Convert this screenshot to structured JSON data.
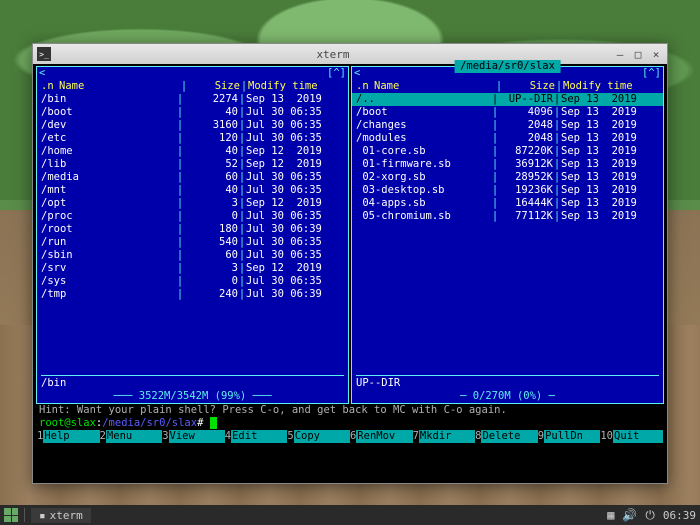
{
  "window": {
    "title": "xterm",
    "minimize": "–",
    "maximize": "□",
    "close": "×"
  },
  "left_panel": {
    "path": "~",
    "headers": {
      "dot": ".n",
      "name": "Name",
      "size": "Size",
      "modify": "Modify time"
    },
    "rows": [
      {
        "name": "/bin",
        "size": "2274",
        "mod": "Sep 13  2019"
      },
      {
        "name": "/boot",
        "size": "40",
        "mod": "Jul 30 06:35"
      },
      {
        "name": "/dev",
        "size": "3160",
        "mod": "Jul 30 06:35"
      },
      {
        "name": "/etc",
        "size": "120",
        "mod": "Jul 30 06:35"
      },
      {
        "name": "/home",
        "size": "40",
        "mod": "Sep 12  2019"
      },
      {
        "name": "/lib",
        "size": "52",
        "mod": "Sep 12  2019"
      },
      {
        "name": "/media",
        "size": "60",
        "mod": "Jul 30 06:35"
      },
      {
        "name": "/mnt",
        "size": "40",
        "mod": "Jul 30 06:35"
      },
      {
        "name": "/opt",
        "size": "3",
        "mod": "Sep 12  2019"
      },
      {
        "name": "/proc",
        "size": "0",
        "mod": "Jul 30 06:35"
      },
      {
        "name": "/root",
        "size": "180",
        "mod": "Jul 30 06:39"
      },
      {
        "name": "/run",
        "size": "540",
        "mod": "Jul 30 06:35"
      },
      {
        "name": "/sbin",
        "size": "60",
        "mod": "Jul 30 06:35"
      },
      {
        "name": "/srv",
        "size": "3",
        "mod": "Sep 12  2019"
      },
      {
        "name": "/sys",
        "size": "0",
        "mod": "Jul 30 06:35"
      },
      {
        "name": "/tmp",
        "size": "240",
        "mod": "Jul 30 06:39"
      }
    ],
    "info": "/bin",
    "disk": "3522M/3542M (99%)"
  },
  "right_panel": {
    "path": "/media/sr0/slax",
    "headers": {
      "dot": ".n",
      "name": "Name",
      "size": "Size",
      "modify": "Modify time"
    },
    "rows": [
      {
        "name": "/..",
        "size": "UP--DIR",
        "mod": "Sep 13  2019",
        "sel": true
      },
      {
        "name": "/boot",
        "size": "4096",
        "mod": "Sep 13  2019"
      },
      {
        "name": "/changes",
        "size": "2048",
        "mod": "Sep 13  2019"
      },
      {
        "name": "/modules",
        "size": "2048",
        "mod": "Sep 13  2019"
      },
      {
        "name": " 01-core.sb",
        "size": "87220K",
        "mod": "Sep 13  2019"
      },
      {
        "name": " 01-firmware.sb",
        "size": "36912K",
        "mod": "Sep 13  2019"
      },
      {
        "name": " 02-xorg.sb",
        "size": "28952K",
        "mod": "Sep 13  2019"
      },
      {
        "name": " 03-desktop.sb",
        "size": "19236K",
        "mod": "Sep 13  2019"
      },
      {
        "name": " 04-apps.sb",
        "size": "16444K",
        "mod": "Sep 13  2019"
      },
      {
        "name": " 05-chromium.sb",
        "size": "77112K",
        "mod": "Sep 13  2019"
      }
    ],
    "info": "UP--DIR",
    "disk": "0/270M (0%)"
  },
  "hint": "Hint: Want your plain shell? Press C-o, and get back to MC with C-o again.",
  "prompt": {
    "user": "root@slax",
    "sep": ":",
    "path": "/media/sr0/slax",
    "end": "#"
  },
  "fkeys": [
    {
      "n": "1",
      "l": "Help"
    },
    {
      "n": "2",
      "l": "Menu"
    },
    {
      "n": "3",
      "l": "View"
    },
    {
      "n": "4",
      "l": "Edit"
    },
    {
      "n": "5",
      "l": "Copy"
    },
    {
      "n": "6",
      "l": "RenMov"
    },
    {
      "n": "7",
      "l": "Mkdir"
    },
    {
      "n": "8",
      "l": "Delete"
    },
    {
      "n": "9",
      "l": "PullDn"
    },
    {
      "n": "10",
      "l": "Quit"
    }
  ],
  "taskbar": {
    "task": "xterm",
    "time": "06:39"
  }
}
